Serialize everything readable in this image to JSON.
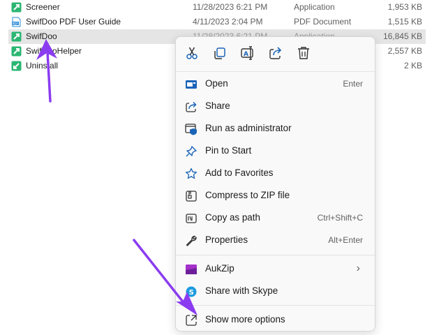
{
  "files": [
    {
      "name": "Screener",
      "date": "11/28/2023 6:21 PM",
      "type": "Application",
      "size": "1,953 KB",
      "icon": "swifdoo-app-icon"
    },
    {
      "name": "SwifDoo PDF User Guide",
      "date": "4/11/2023 2:04 PM",
      "type": "PDF Document",
      "size": "1,515 KB",
      "icon": "pdf-file-icon"
    },
    {
      "name": "SwifDoo",
      "date": "11/28/2023 6:21 PM",
      "type": "Application",
      "size": "16,845 KB",
      "icon": "swifdoo-app-icon",
      "selected": true
    },
    {
      "name": "SwifDooHelper",
      "date": "",
      "type": "",
      "size": "2,557 KB",
      "icon": "swifdoo-app-icon"
    },
    {
      "name": "Uninstall",
      "date": "",
      "type": "",
      "size": "2 KB",
      "icon": "uninstall-app-icon"
    }
  ],
  "context_menu": {
    "quick_actions": [
      {
        "name": "cut",
        "icon": "scissors-icon"
      },
      {
        "name": "copy",
        "icon": "copy-icon"
      },
      {
        "name": "rename",
        "icon": "rename-icon"
      },
      {
        "name": "share",
        "icon": "share-icon"
      },
      {
        "name": "delete",
        "icon": "trash-icon"
      }
    ],
    "items": [
      {
        "label": "Open",
        "shortcut": "Enter",
        "icon": "open-app-icon"
      },
      {
        "label": "Share",
        "shortcut": "",
        "icon": "share-icon"
      },
      {
        "label": "Run as administrator",
        "shortcut": "",
        "icon": "shield-icon"
      },
      {
        "label": "Pin to Start",
        "shortcut": "",
        "icon": "pin-icon"
      },
      {
        "label": "Add to Favorites",
        "shortcut": "",
        "icon": "star-icon"
      },
      {
        "label": "Compress to ZIP file",
        "shortcut": "",
        "icon": "zip-icon"
      },
      {
        "label": "Copy as path",
        "shortcut": "Ctrl+Shift+C",
        "icon": "copy-path-icon"
      },
      {
        "label": "Properties",
        "shortcut": "Alt+Enter",
        "icon": "wrench-icon"
      },
      {
        "label": "AukZip",
        "shortcut": "",
        "icon": "aukzip-icon",
        "has_submenu": true
      },
      {
        "label": "Share with Skype",
        "shortcut": "",
        "icon": "skype-icon"
      },
      {
        "label": "Show more options",
        "shortcut": "",
        "icon": "expand-icon"
      }
    ]
  },
  "colors": {
    "selected_row": "#e5e5e5",
    "menu_background": "#f9f9f9",
    "icon_blue": "#1a64b8",
    "annotation_arrow": "#8b3cf0",
    "app_icon_green": "#2bb673"
  }
}
